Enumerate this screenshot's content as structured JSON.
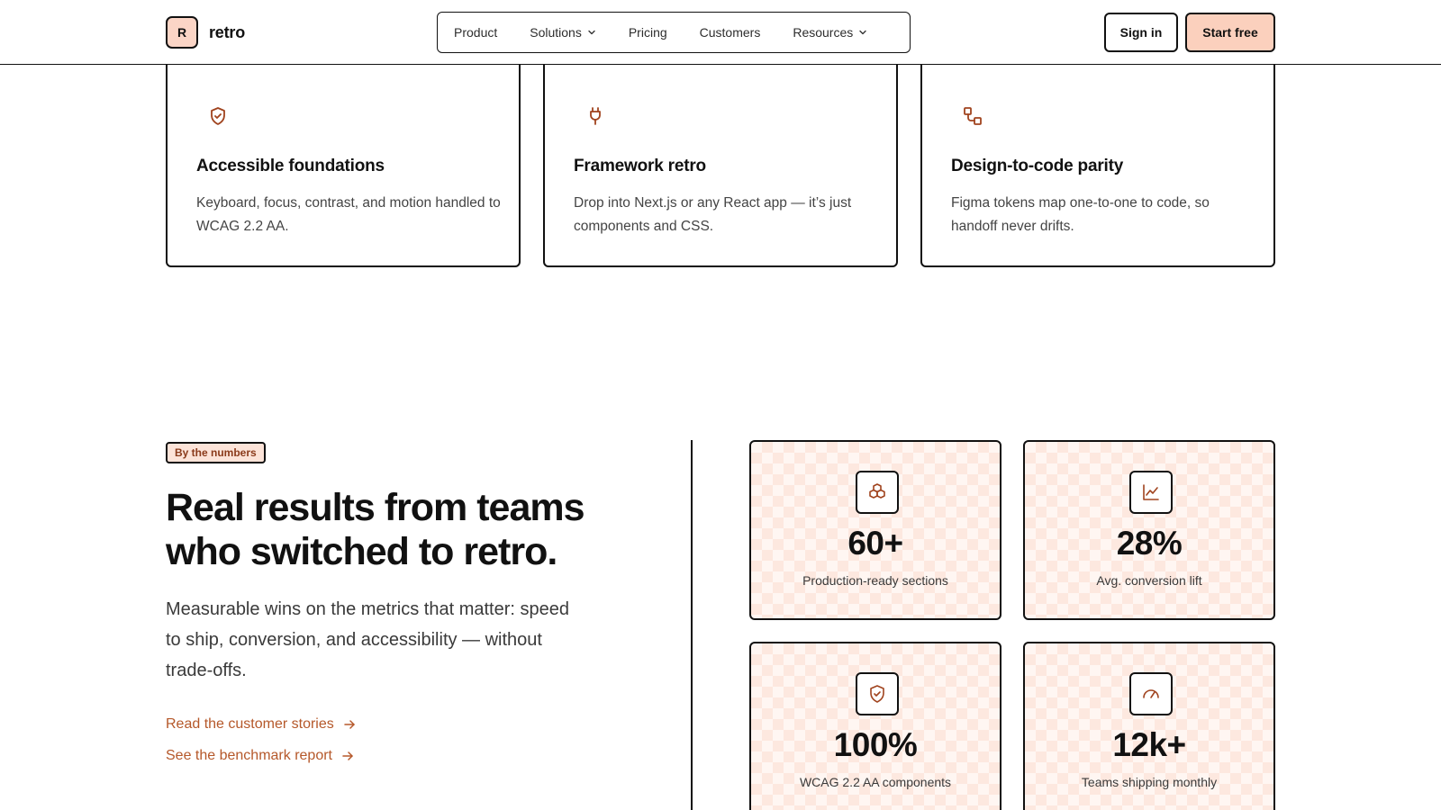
{
  "header": {
    "brand_mark": "R",
    "brand_name": "retro",
    "nav": [
      {
        "label": "Product"
      },
      {
        "label": "Solutions"
      },
      {
        "label": "Pricing"
      },
      {
        "label": "Customers"
      },
      {
        "label": "Resources"
      }
    ],
    "sign_in": "Sign in",
    "start_free": "Start free"
  },
  "features": [
    {
      "icon": "shield-check-icon",
      "title": "Accessible foundations",
      "desc": "Keyboard, focus, contrast, and motion handled to WCAG 2.2 AA."
    },
    {
      "icon": "plug-icon",
      "title": "Framework retro",
      "desc": "Drop into Next.js or any React app — it’s just components and CSS."
    },
    {
      "icon": "workflow-icon",
      "title": "Design-to-code parity",
      "desc": "Figma tokens map one-to-one to code, so handoff never drifts."
    }
  ],
  "numbers": {
    "badge": "By the numbers",
    "headline": "Real results from teams who switched to retro.",
    "lede": "Measurable wins on the metrics that matter: speed to ship, conversion, and accessibility — without trade-offs.",
    "links": [
      {
        "label": "Read the customer stories"
      },
      {
        "label": "See the benchmark report"
      }
    ],
    "stats": [
      {
        "icon": "boxes-icon",
        "value": "60+",
        "label": "Production-ready sections"
      },
      {
        "icon": "line-chart-icon",
        "value": "28%",
        "label": "Avg. conversion lift"
      },
      {
        "icon": "shield-check-icon",
        "value": "100%",
        "label": "WCAG 2.2 AA components"
      },
      {
        "icon": "gauge-icon",
        "value": "12k+",
        "label": "Teams shipping monthly"
      }
    ]
  },
  "colors": {
    "accent": "#a0431e",
    "link": "#b5582a",
    "button_fill": "#fbd0bd",
    "card_tint": "#fff6f2"
  }
}
